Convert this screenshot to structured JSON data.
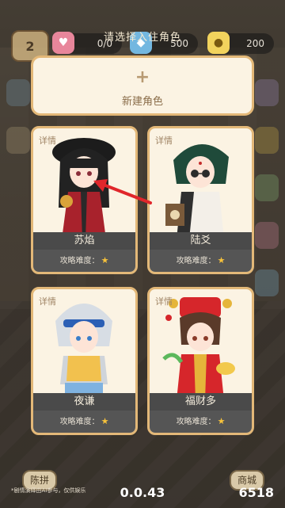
{
  "header": {
    "title": "请选择入住角色",
    "level": "2",
    "resources": [
      {
        "icon": "heart-icon",
        "value": "0/0"
      },
      {
        "icon": "gem-icon",
        "value": "500"
      },
      {
        "icon": "coin-icon",
        "value": "200"
      }
    ]
  },
  "new_character": {
    "plus": "+",
    "label": "新建角色"
  },
  "characters": [
    {
      "tag": "详情",
      "name": "苏焰",
      "difficulty_label": "攻略难度：",
      "stars": "★"
    },
    {
      "tag": "详情",
      "name": "陆爻",
      "difficulty_label": "攻略难度：",
      "stars": "★"
    },
    {
      "tag": "详情",
      "name": "夜谦",
      "difficulty_label": "攻略难度：",
      "stars": "★"
    },
    {
      "tag": "详情",
      "name": "福财多",
      "difficulty_label": "攻略难度：",
      "stars": "★"
    }
  ],
  "footer": {
    "left_button": "陈拼",
    "right_button": "商城",
    "disclaimer": "*剧情演绎由AI参与，仅供娱乐",
    "version": "0.0.43",
    "currency": "6518"
  },
  "colors": {
    "card_bg": "#fbf3e3",
    "card_border": "#e3b878",
    "name_bar": "#4a4a4a",
    "star": "#f7c23b",
    "arrow": "#e0262b"
  }
}
